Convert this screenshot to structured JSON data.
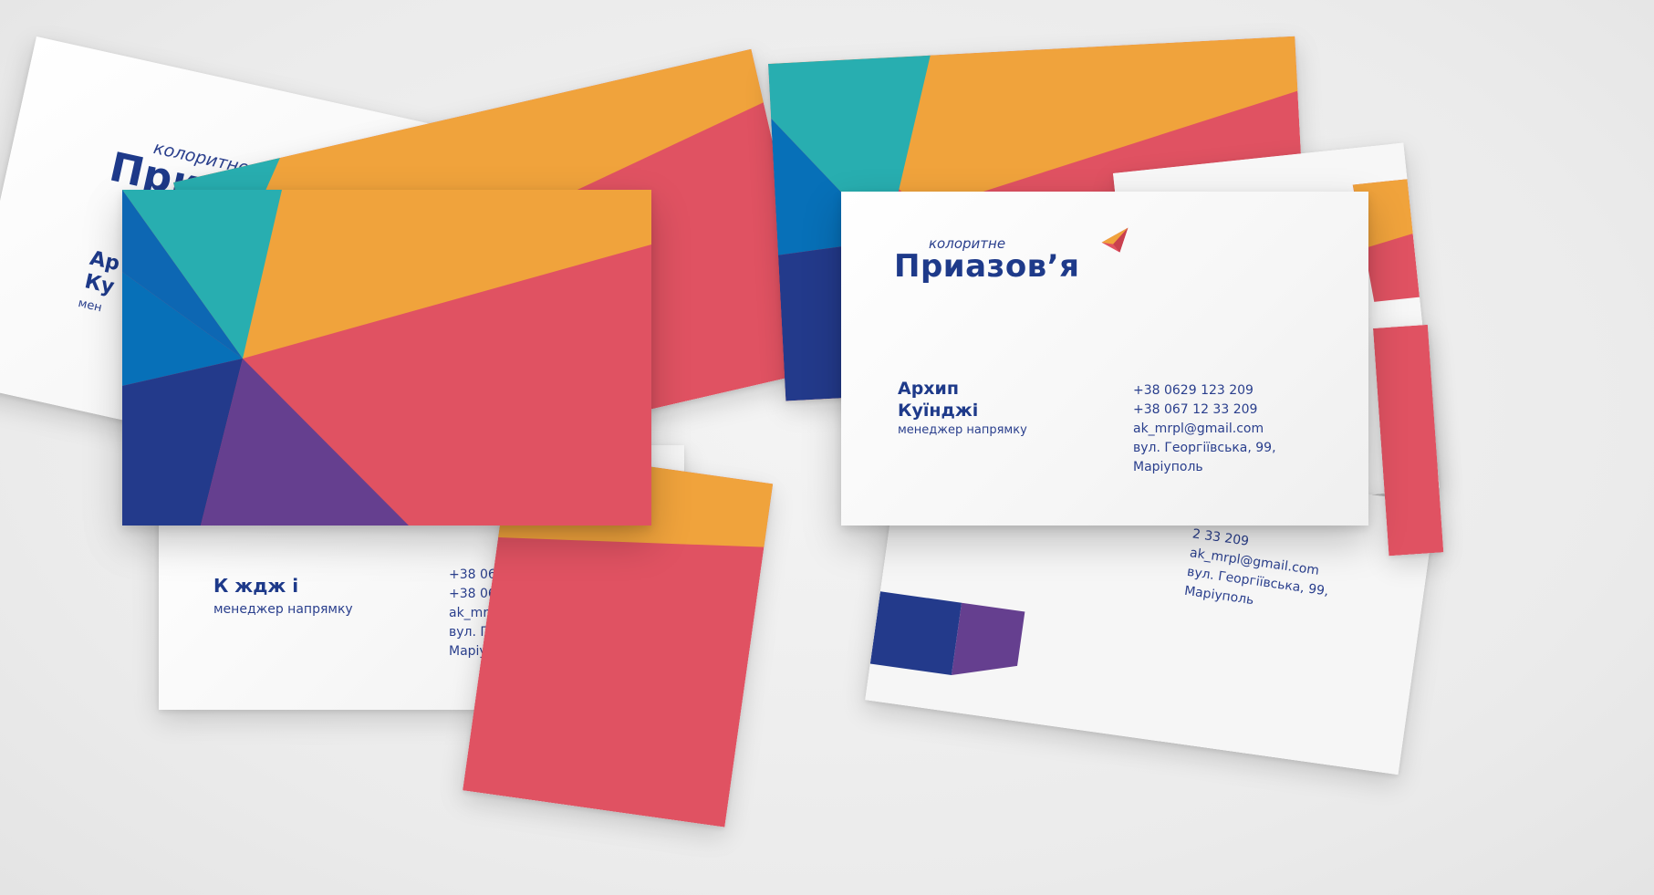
{
  "brand": {
    "tagline": "колоритне",
    "name": "Приазов’я",
    "colors": {
      "navy": "#1e3a8a",
      "blue": "#0770b8",
      "teal": "#28aeb0",
      "orange": "#f0a33c",
      "coral": "#e05262",
      "purple": "#653f8f",
      "dark_blue": "#233a8b"
    },
    "icon": "paper-plane-icon"
  },
  "person": {
    "first_name": "Архип",
    "last_name": "Куїнджі",
    "role": "менеджер напрямку"
  },
  "contacts": {
    "phone_1": "+38 0629 123 209",
    "phone_2": "+38 067 12 33 209",
    "email": "ak_mrpl@gmail.com",
    "street": "вул. Георгіївська, 99,",
    "city": "Маріуполь"
  },
  "partial": {
    "name_line_1": "Ар",
    "name_line_2": "Ку",
    "role_line": "мен",
    "name_fragment": "К ждж і",
    "phone_fragment": "2 33 209"
  }
}
